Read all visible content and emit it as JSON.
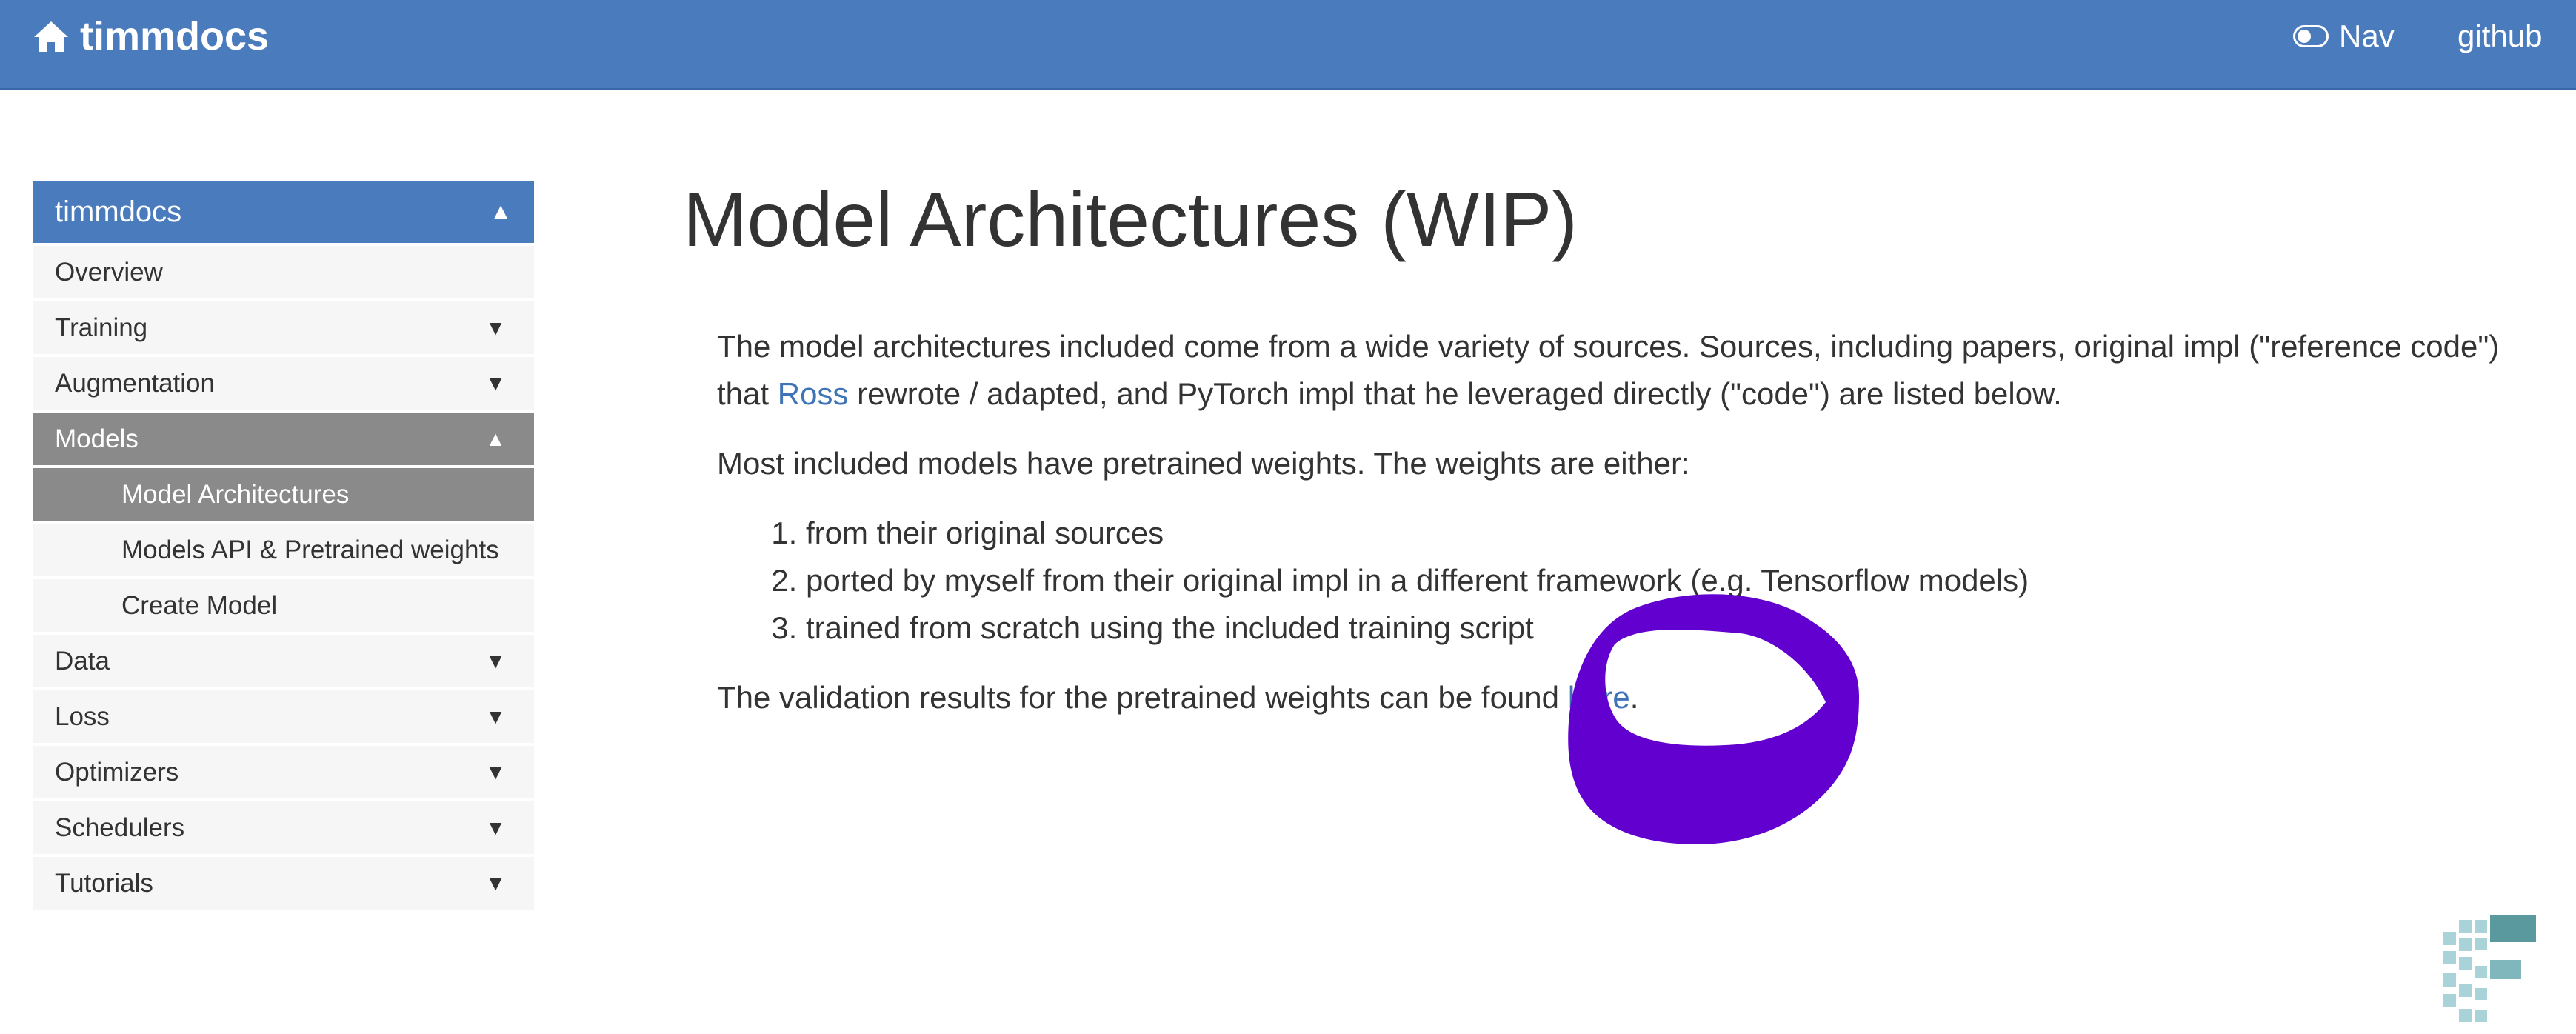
{
  "header": {
    "brand_label": "timmdocs",
    "brand_icon": "home-icon",
    "nav_label": "Nav",
    "nav_icon": "toggle-icon",
    "github_label": "github",
    "colors": {
      "bar": "#497bbd",
      "text": "#ffffff"
    }
  },
  "sidebar": {
    "header_label": "timmdocs",
    "items": [
      {
        "label": "Overview"
      },
      {
        "label": "Training"
      },
      {
        "label": "Augmentation"
      },
      {
        "label": "Models"
      },
      {
        "label": "Model Architectures"
      },
      {
        "label": "Models API & Pretrained weights"
      },
      {
        "label": "Create Model"
      },
      {
        "label": "Data"
      },
      {
        "label": "Loss"
      },
      {
        "label": "Optimizers"
      },
      {
        "label": "Schedulers"
      },
      {
        "label": "Tutorials"
      }
    ],
    "caret_down": "▼",
    "caret_up": "▲",
    "colors": {
      "header": "#497bbd",
      "active": "#8a8a8a",
      "item": "#f6f6f6"
    }
  },
  "main": {
    "title": "Model Architectures (WIP)",
    "p1_before": "The model architectures included come from a wide variety of sources. Sources, including papers, original impl (\"reference code\") that ",
    "p1_link": "Ross",
    "p1_after": " rewrote / adapted, and PyTorch impl that he leveraged directly (\"code\") are listed below.",
    "p2": "Most included models have pretrained weights. The weights are either:",
    "list": [
      "from their original sources",
      "ported by myself from their original impl in a different framework (e.g. Tensorflow models)",
      "trained from scratch using the included training script"
    ],
    "p3_before": "The validation results for the pretrained weights can be found ",
    "p3_link": "here",
    "p3_after": ".",
    "colors": {
      "link": "#3f74b7",
      "text": "#333333"
    }
  },
  "overlay": {
    "scribble_color": "#6200d0",
    "logo_icon": "pixel-logo-icon"
  }
}
